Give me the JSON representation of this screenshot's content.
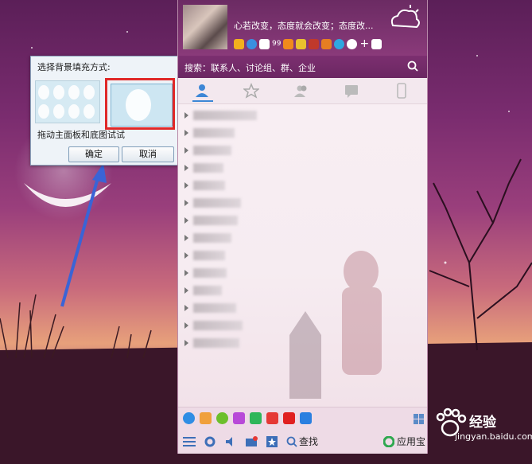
{
  "dialog": {
    "title": "选择背景填充方式:",
    "hint": "拖动主面板和底图试试",
    "ok_label": "确定",
    "cancel_label": "取消"
  },
  "profile": {
    "signature": "心若改变，态度就会改变；态度改..."
  },
  "search": {
    "placeholder": "搜索：联系人、讨论组、群、企业"
  },
  "toolbar": {
    "badge_count": "99"
  },
  "bottom": {
    "find_label": "查找",
    "appstore_label": "应用宝"
  },
  "watermark": {
    "brand": "经验",
    "url": "jingyan.baidu.com"
  },
  "colors": {
    "accent_blue": "#3d87d6",
    "highlight_red": "#e02828",
    "header_purple": "#7c2f70"
  }
}
